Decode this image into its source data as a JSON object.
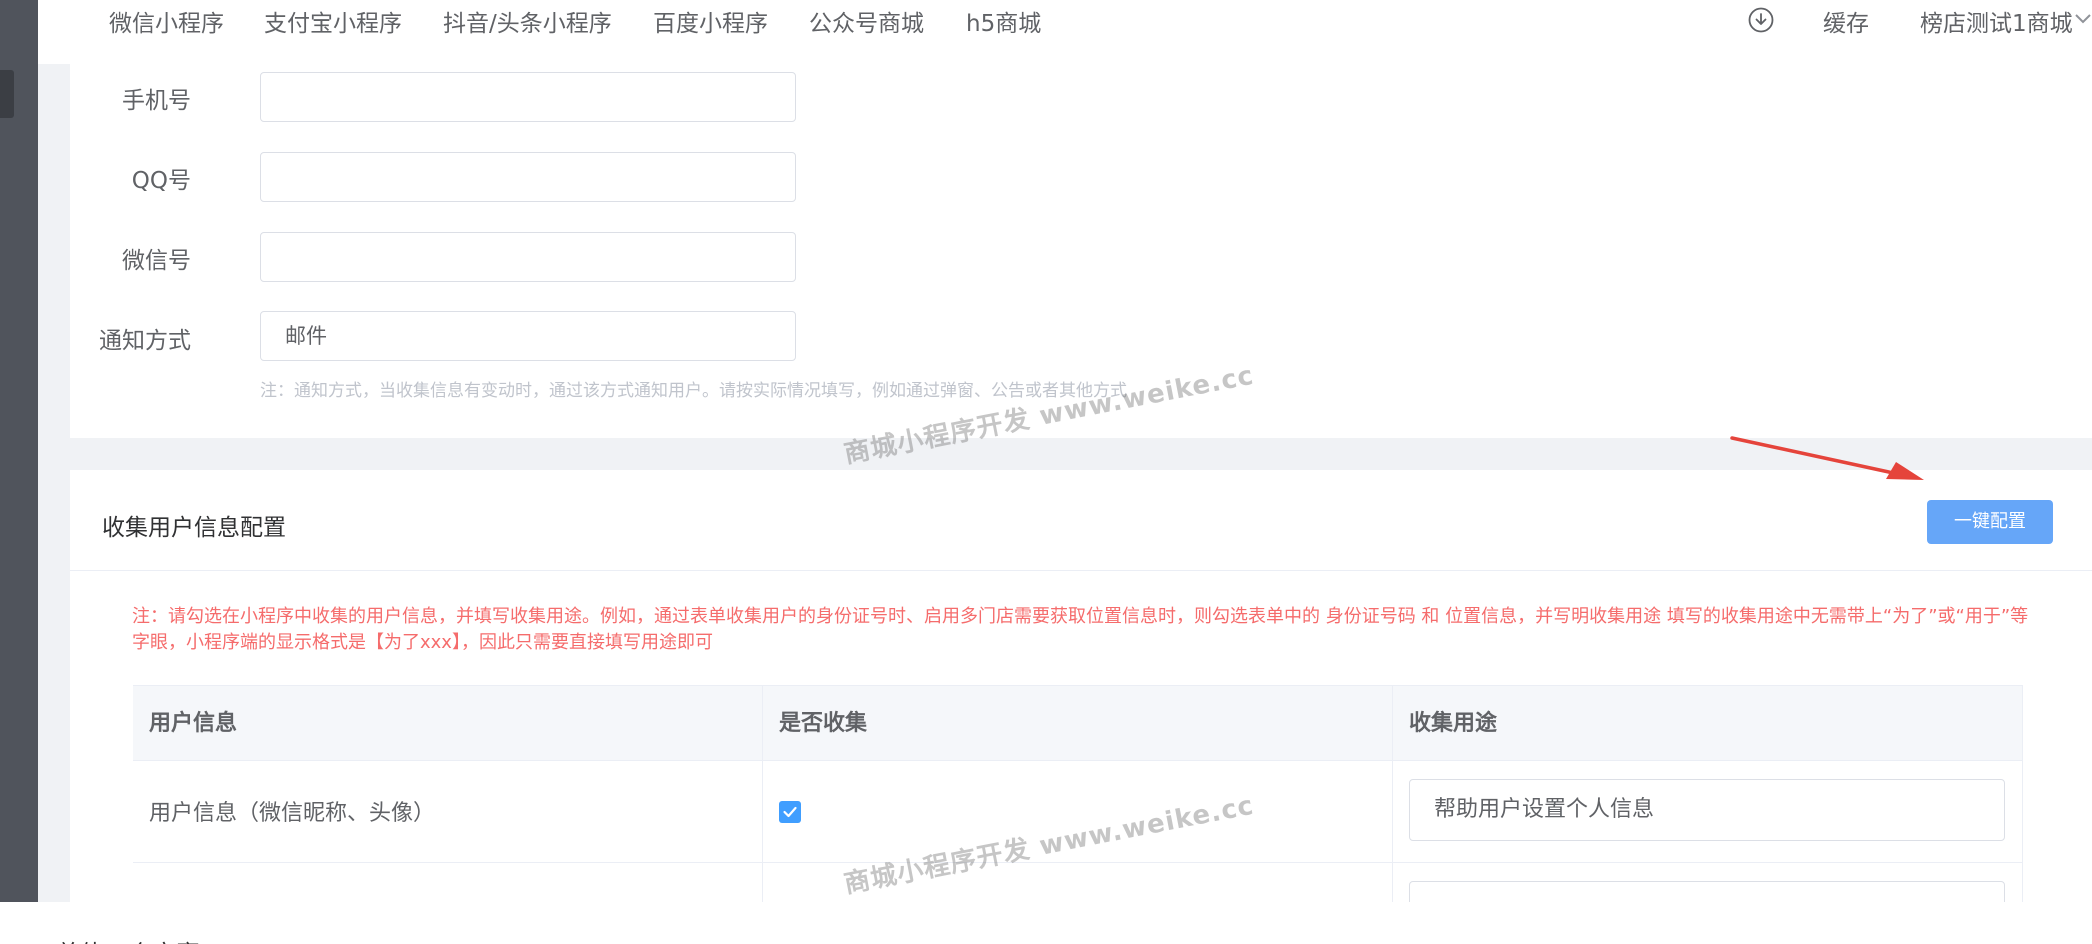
{
  "topnav": {
    "items": [
      "微信小程序",
      "支付宝小程序",
      "抖音/头条小程序",
      "百度小程序",
      "公众号商城",
      "h5商城"
    ],
    "cache_label": "缓存",
    "shop_name": "榜店测试1商城",
    "download_icon": "download-circle-icon",
    "dropdown_icon": "chevron-down-icon"
  },
  "contact_form": {
    "phone_label": "手机号",
    "phone_value": "",
    "qq_label": "QQ号",
    "qq_value": "",
    "wechat_label": "微信号",
    "wechat_value": "",
    "notify_label": "通知方式",
    "notify_value": "邮件",
    "hint": "注：通知方式，当收集信息有变动时，通过该方式通知用户。请按实际情况填写，例如通过弹窗、公告或者其他方式"
  },
  "collect_config": {
    "title": "收集用户信息配置",
    "one_click_button": "一键配置",
    "notice": "注：请勾选在小程序中收集的用户信息，并填写收集用途。例如，通过表单收集用户的身份证号时、启用多门店需要获取位置信息时，则勾选表单中的 身份证号码 和 位置信息，并写明收集用途 填写的收集用途中无需带上“为了”或“用于”等字眼，小程序端的显示格式是【为了xxx】，因此只需要直接填写用途即可",
    "table": {
      "headers": [
        "用户信息",
        "是否收集",
        "收集用途"
      ],
      "rows": [
        {
          "info": "用户信息（微信昵称、头像）",
          "collected": true,
          "purpose": "帮助用户设置个人信息"
        },
        {
          "info": "",
          "collected": false,
          "purpose": ""
        }
      ]
    }
  },
  "watermark": "商城小程序开发 www.weike.cc",
  "bottom_text": "总体一个方案",
  "colors": {
    "primary": "#409eff",
    "button": "#66a6f8",
    "warning_text": "#f56c6c",
    "arrow": "#e5443b",
    "sidebar": "#50545c"
  }
}
